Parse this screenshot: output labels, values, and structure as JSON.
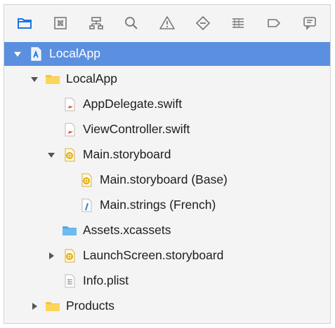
{
  "toolbar": {
    "icons": [
      "folder-icon",
      "source-control-icon",
      "hierarchy-icon",
      "search-icon",
      "warning-icon",
      "breakpoint-diamond-icon",
      "list-icon",
      "tag-icon",
      "chat-icon"
    ]
  },
  "colors": {
    "selection": "#5b8fe0",
    "accent": "#1b74e8",
    "folder_yellow": "#f5c43a",
    "swift_orange": "#f05138"
  },
  "tree": [
    {
      "label": "LocalApp",
      "icon": "project-icon",
      "disclosure": "expanded"
    },
    {
      "label": "LocalApp",
      "icon": "folder-icon",
      "disclosure": "expanded"
    },
    {
      "label": "AppDelegate.swift",
      "icon": "swift-file-icon",
      "disclosure": "none"
    },
    {
      "label": "ViewController.swift",
      "icon": "swift-file-icon",
      "disclosure": "none"
    },
    {
      "label": "Main.storyboard",
      "icon": "storyboard-icon",
      "disclosure": "expanded"
    },
    {
      "label": "Main.storyboard (Base)",
      "icon": "storyboard-icon",
      "disclosure": "none"
    },
    {
      "label": "Main.strings (French)",
      "icon": "strings-file-icon",
      "disclosure": "none"
    },
    {
      "label": "Assets.xcassets",
      "icon": "assets-folder-icon",
      "disclosure": "none"
    },
    {
      "label": "LaunchScreen.storyboard",
      "icon": "storyboard-icon",
      "disclosure": "collapsed"
    },
    {
      "label": "Info.plist",
      "icon": "plist-file-icon",
      "disclosure": "none"
    },
    {
      "label": "Products",
      "icon": "folder-icon",
      "disclosure": "collapsed"
    }
  ]
}
